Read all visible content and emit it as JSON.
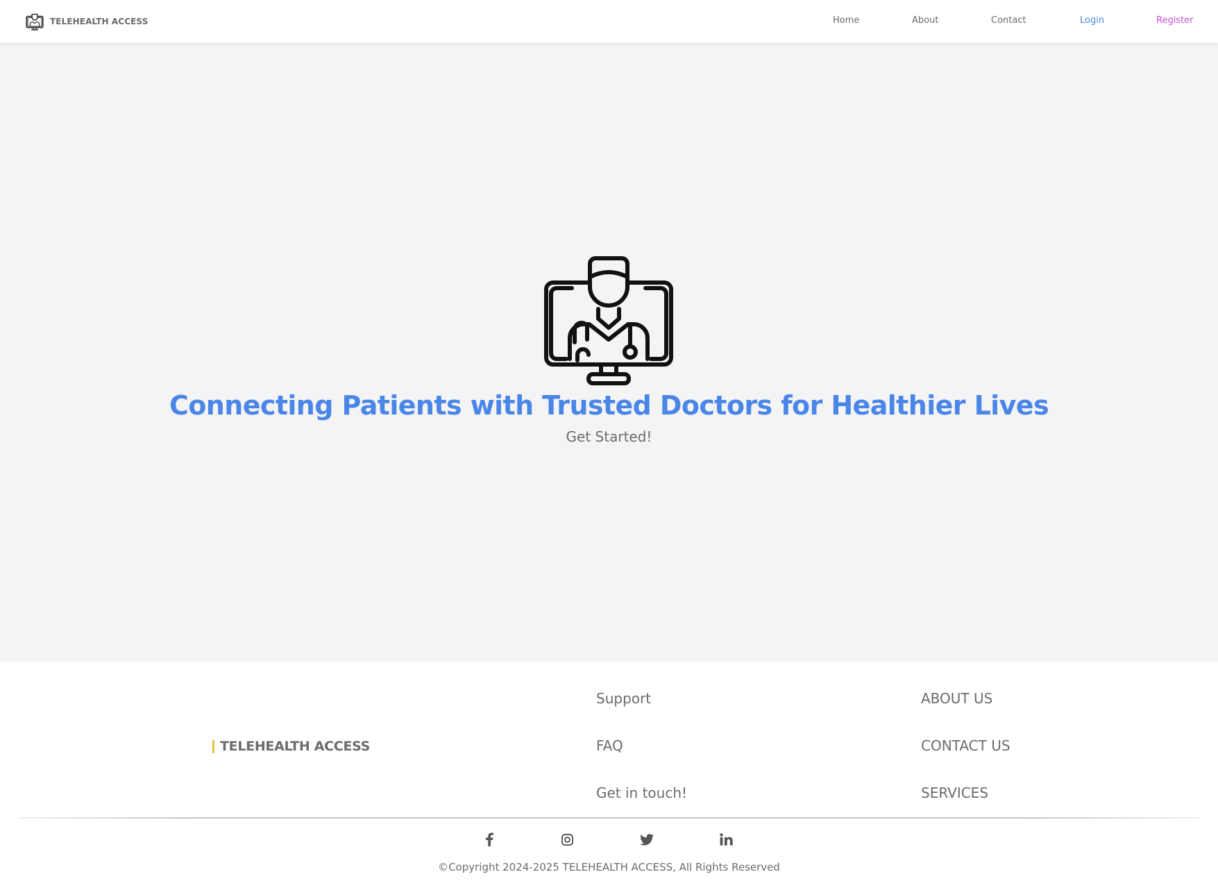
{
  "colors": {
    "accent_blue": "#4a86e8",
    "register_purple": "#c64ed6",
    "footer_accent_yellow": "#e9c23b",
    "text_gray": "#6b6b6b",
    "hero_bg": "#f4f4f4"
  },
  "navbar": {
    "brand_icon": "telehealth-monitor-doctor-icon",
    "brand_text": "TELEHEALTH ACCESS",
    "links": {
      "home": "Home",
      "about": "About",
      "contact": "Contact",
      "login": "Login",
      "register": "Register"
    }
  },
  "hero": {
    "icon": "doctor-on-monitor-icon",
    "title": "Connecting Patients with Trusted Doctors for Healthier Lives",
    "cta": "Get Started!"
  },
  "footer": {
    "brand_text": "TELEHEALTH ACCESS",
    "column_1": {
      "support": "Support",
      "faq": "FAQ",
      "get_in_touch": "Get in touch!"
    },
    "column_2": {
      "about_us": "ABOUT US",
      "contact_us": "CONTACT US",
      "services": "SERVICES"
    },
    "social_icons": [
      "facebook-icon",
      "instagram-icon",
      "twitter-icon",
      "linkedin-icon"
    ],
    "copyright": "©Copyright 2024-2025 TELEHEALTH ACCESS, All Rights Reserved"
  }
}
